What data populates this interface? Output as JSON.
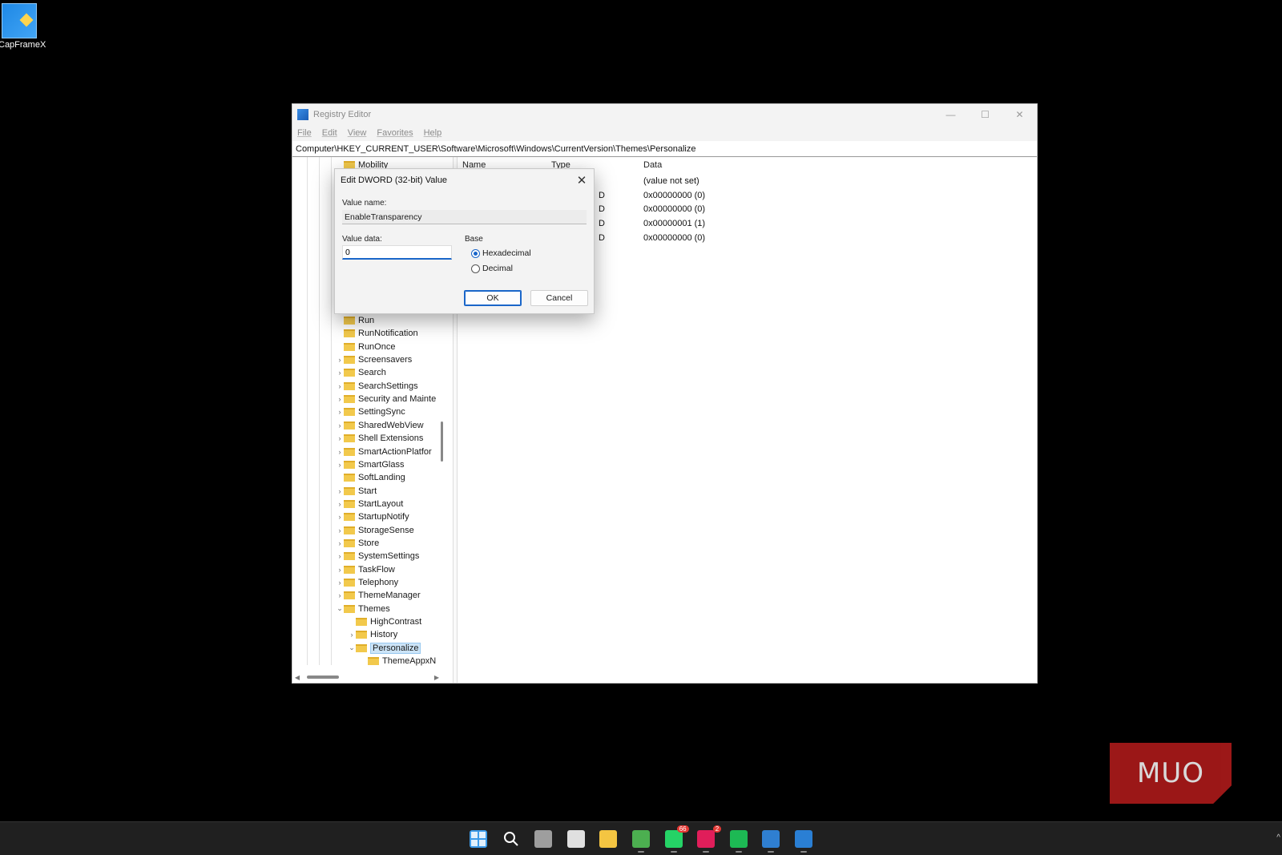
{
  "desktop": {
    "icon_label": "CapFrameX"
  },
  "window": {
    "title": "Registry Editor",
    "controls": {
      "minimize": "—",
      "maximize": "☐",
      "close": "✕"
    },
    "menu": [
      "File",
      "Edit",
      "View",
      "Favorites",
      "Help"
    ],
    "address": "Computer\\HKEY_CURRENT_USER\\Software\\Microsoft\\Windows\\CurrentVersion\\Themes\\Personalize"
  },
  "tree": {
    "items": [
      {
        "label": "Mobility",
        "expander": ""
      },
      {
        "label": "Run",
        "expander": ""
      },
      {
        "label": "RunNotification",
        "expander": ""
      },
      {
        "label": "RunOnce",
        "expander": ""
      },
      {
        "label": "Screensavers",
        "expander": "›"
      },
      {
        "label": "Search",
        "expander": "›"
      },
      {
        "label": "SearchSettings",
        "expander": "›"
      },
      {
        "label": "Security and Mainte",
        "expander": "›"
      },
      {
        "label": "SettingSync",
        "expander": "›"
      },
      {
        "label": "SharedWebView",
        "expander": "›"
      },
      {
        "label": "Shell Extensions",
        "expander": "›"
      },
      {
        "label": "SmartActionPlatfor",
        "expander": "›"
      },
      {
        "label": "SmartGlass",
        "expander": "›"
      },
      {
        "label": "SoftLanding",
        "expander": ""
      },
      {
        "label": "Start",
        "expander": "›"
      },
      {
        "label": "StartLayout",
        "expander": "›"
      },
      {
        "label": "StartupNotify",
        "expander": "›"
      },
      {
        "label": "StorageSense",
        "expander": "›"
      },
      {
        "label": "Store",
        "expander": "›"
      },
      {
        "label": "SystemSettings",
        "expander": "›"
      },
      {
        "label": "TaskFlow",
        "expander": "›"
      },
      {
        "label": "Telephony",
        "expander": "›"
      },
      {
        "label": "ThemeManager",
        "expander": "›"
      },
      {
        "label": "Themes",
        "expander": "⌄"
      },
      {
        "label": "HighContrast",
        "expander": ""
      },
      {
        "label": "History",
        "expander": "›"
      },
      {
        "label": "Personalize",
        "expander": "⌄"
      },
      {
        "label": "ThemeAppxN",
        "expander": ""
      }
    ],
    "selected": "Personalize"
  },
  "list": {
    "columns": {
      "name": "Name",
      "type": "Type",
      "data": "Data"
    },
    "rows": [
      {
        "type_fragment": "",
        "data": "(value not set)"
      },
      {
        "type_fragment": "D",
        "data": "0x00000000 (0)"
      },
      {
        "type_fragment": "D",
        "data": "0x00000000 (0)"
      },
      {
        "type_fragment": "D",
        "data": "0x00000001 (1)"
      },
      {
        "type_fragment": "D",
        "data": "0x00000000 (0)"
      }
    ]
  },
  "dialog": {
    "title": "Edit DWORD (32-bit) Value",
    "close": "✕",
    "value_name_label": "Value name:",
    "value_name": "EnableTransparency",
    "value_data_label": "Value data:",
    "value_data": "0",
    "base_label": "Base",
    "base_options": [
      "Hexadecimal",
      "Decimal"
    ],
    "base_selected": "Hexadecimal",
    "ok": "OK",
    "cancel": "Cancel"
  },
  "taskbar": {
    "apps": [
      {
        "name": "start",
        "color": "#3d9be9"
      },
      {
        "name": "search",
        "color": "#202020"
      },
      {
        "name": "task-view",
        "color": "#9e9e9e"
      },
      {
        "name": "store",
        "color": "#e0e0e0"
      },
      {
        "name": "file-explorer",
        "color": "#f4c542"
      },
      {
        "name": "chrome",
        "color": "#4caf50"
      },
      {
        "name": "whatsapp",
        "color": "#25d366",
        "badge": "66"
      },
      {
        "name": "slack",
        "color": "#e01e5a",
        "badge": "2"
      },
      {
        "name": "spotify",
        "color": "#1db954"
      },
      {
        "name": "photos",
        "color": "#2f7fd1"
      },
      {
        "name": "registry-editor",
        "color": "#2a7fd4"
      }
    ]
  },
  "watermark": {
    "text": "MUO"
  }
}
